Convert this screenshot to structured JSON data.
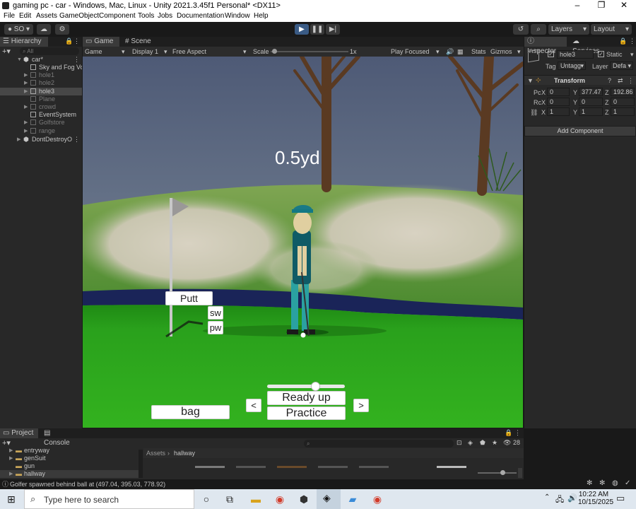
{
  "window": {
    "title": "gaming pc - car - Windows, Mac, Linux - Unity 2021.3.45f1 Personal* <DX11>"
  },
  "menu": [
    "File",
    "Edit",
    "Assets",
    "GameObject",
    "Component",
    "Tools",
    "Jobs",
    "Documentation",
    "Window",
    "Help"
  ],
  "toolbar": {
    "account": "SO",
    "layers": "Layers",
    "layout": "Layout"
  },
  "hierarchy": {
    "tab": "Hierarchy",
    "search_placeholder": "All",
    "items": [
      {
        "label": "car*"
      },
      {
        "label": "Sky and Fog Vo"
      },
      {
        "label": "hole1"
      },
      {
        "label": "hole2"
      },
      {
        "label": "hole3"
      },
      {
        "label": "Plane"
      },
      {
        "label": "crowd"
      },
      {
        "label": "EventSystem"
      },
      {
        "label": "Golfstore"
      },
      {
        "label": "range"
      },
      {
        "label": "DontDestroyO"
      }
    ]
  },
  "game": {
    "tabs": [
      "Game",
      "Scene"
    ],
    "mode": "Game",
    "display": "Display 1",
    "aspect": "Free Aspect",
    "scale_label": "Scale",
    "scale_value": "1x",
    "play_focused": "Play Focused",
    "stats": "Stats",
    "gizmos": "Gizmos",
    "hud": {
      "distance": "0.5yd",
      "putt": "Putt",
      "sw": "sw",
      "pw": "pw",
      "bag": "bag",
      "prev": "<",
      "next": ">",
      "ready": "Ready up",
      "practice": "Practice"
    }
  },
  "inspector": {
    "tabs": [
      "Inspector",
      "Services"
    ],
    "object_name": "hole3",
    "static_label": "Static",
    "tag_label": "Tag",
    "tag_value": "Untagg",
    "layer_label": "Layer",
    "layer_value": "Defa",
    "transform_title": "Transform",
    "position": {
      "label": "Pc",
      "x": "0",
      "y": "377.47",
      "z": "192.86"
    },
    "rotation": {
      "label": "Rc",
      "x": "0",
      "y": "0",
      "z": "0"
    },
    "scale": {
      "x": "1",
      "y": "1",
      "z": "1"
    },
    "axis": {
      "x": "X",
      "y": "Y",
      "z": "Z"
    },
    "add_component": "Add Component"
  },
  "project": {
    "tabs": [
      "Project",
      "Console"
    ],
    "folders": [
      "entryway",
      "genSuit",
      "gun",
      "hallway"
    ],
    "breadcrumb_root": "Assets",
    "breadcrumb_leaf": "hallway",
    "count": "28"
  },
  "status": {
    "message": "Golfer spawned behind ball at (497.04, 395.03, 778.92)"
  },
  "taskbar": {
    "search_placeholder": "Type here to search",
    "time": "10:22 AM",
    "date": "10/15/2025"
  }
}
